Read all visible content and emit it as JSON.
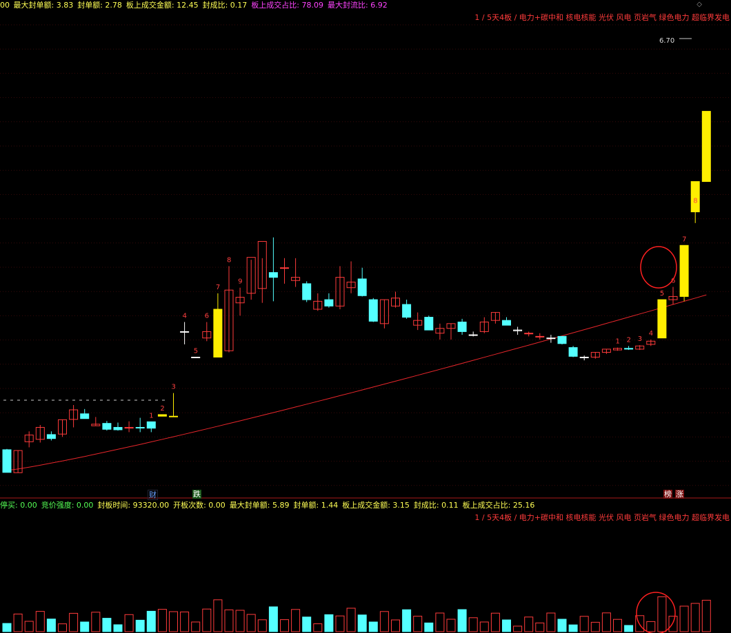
{
  "top_stats": [
    {
      "label": "最大封单额: ",
      "value": "3.83",
      "color": "#ffff55"
    },
    {
      "label": "封单额: ",
      "value": "2.78",
      "color": "#ffff55"
    },
    {
      "label": "板上成交金额: ",
      "value": "12.45",
      "color": "#ffff55"
    },
    {
      "label": "封成比: ",
      "value": "0.17",
      "color": "#ffff55"
    },
    {
      "label": "板上成交占比: ",
      "value": "78.09",
      "color": "#ff44ff"
    },
    {
      "label": "最大封流比: ",
      "value": "6.92",
      "color": "#ff44ff"
    }
  ],
  "top_prefix": "00",
  "concepts": "1 / 5天4板 / 电力+碳中和 核电核能 光伏 风电 页岩气 绿色电力 超临界发电",
  "price_label": "6.70",
  "ma_color": "#e8262b",
  "flags": {
    "cai": "财",
    "die": "跌",
    "bang": "榜",
    "zhang": "涨"
  },
  "bottom_stats": [
    {
      "label": "停买: ",
      "value": "0.00",
      "color": "#55ff55"
    },
    {
      "label": "竞价强度: ",
      "value": "0.00",
      "color": "#55ff55"
    },
    {
      "label": "封板时间: ",
      "value": "93320.00",
      "color": "#ffff55"
    },
    {
      "label": "开板次数: ",
      "value": "0.00",
      "color": "#ffff55"
    },
    {
      "label": "最大封单额: ",
      "value": "5.89",
      "color": "#ffff55"
    },
    {
      "label": "封单额: ",
      "value": "1.44",
      "color": "#ffff55"
    },
    {
      "label": "板上成交金额: ",
      "value": "3.15",
      "color": "#ffff55"
    },
    {
      "label": "封成比: ",
      "value": "0.11",
      "color": "#ffff55"
    },
    {
      "label": "板上成交占比: ",
      "value": "25.16",
      "color": "#ffff55"
    }
  ],
  "chart_data": {
    "type": "candlestick",
    "candles": [
      {
        "o": 6.8,
        "h": 6.85,
        "l": 5.38,
        "c": 5.38,
        "dir": "down"
      },
      {
        "o": 5.36,
        "h": 6.75,
        "l": 5.36,
        "c": 6.75,
        "dir": "up"
      },
      {
        "o": 7.3,
        "h": 7.95,
        "l": 6.95,
        "c": 7.72,
        "dir": "up"
      },
      {
        "o": 7.45,
        "h": 8.35,
        "l": 7.25,
        "c": 8.2,
        "dir": "up"
      },
      {
        "o": 7.75,
        "h": 7.95,
        "l": 7.38,
        "c": 7.5,
        "dir": "down"
      },
      {
        "o": 7.78,
        "h": 8.68,
        "l": 7.6,
        "c": 8.68,
        "dir": "up"
      },
      {
        "o": 8.7,
        "h": 9.6,
        "l": 8.2,
        "c": 9.3,
        "dir": "up"
      },
      {
        "o": 9.05,
        "h": 9.35,
        "l": 8.85,
        "c": 8.75,
        "dir": "down"
      },
      {
        "o": 8.4,
        "h": 8.85,
        "l": 8.3,
        "c": 8.3,
        "dir": "up"
      },
      {
        "o": 8.45,
        "h": 8.6,
        "l": 8.0,
        "c": 8.08,
        "dir": "down"
      },
      {
        "o": 8.2,
        "h": 8.5,
        "l": 8.0,
        "c": 8.05,
        "dir": "down"
      },
      {
        "o": 8.2,
        "h": 8.58,
        "l": 7.9,
        "c": 8.15,
        "dir": "up"
      },
      {
        "o": 8.2,
        "h": 8.8,
        "l": 7.9,
        "c": 8.2,
        "dir": "down"
      },
      {
        "o": 8.15,
        "h": 8.55,
        "l": 7.9,
        "c": 8.55,
        "dir": "down"
      },
      {
        "o": 8.9,
        "h": 9.0,
        "l": 8.9,
        "c": 9.0,
        "dir": "limit"
      },
      {
        "o": 8.9,
        "h": 10.35,
        "l": 8.85,
        "c": 8.9,
        "dir": "limit"
      },
      {
        "o": 14.2,
        "h": 14.8,
        "l": 13.4,
        "c": 14.2,
        "dir": "flat"
      },
      {
        "o": 12.6,
        "h": 12.6,
        "l": 12.6,
        "c": 12.6,
        "dir": "flat"
      },
      {
        "o": 13.8,
        "h": 14.8,
        "l": 13.6,
        "c": 14.2,
        "dir": "up"
      },
      {
        "o": 15.6,
        "h": 16.6,
        "l": 13.3,
        "c": 12.6,
        "dir": "limit"
      },
      {
        "o": 13.0,
        "h": 18.3,
        "l": 12.9,
        "c": 16.8,
        "dir": "up"
      },
      {
        "o": 16.0,
        "h": 16.95,
        "l": 15.2,
        "c": 16.35,
        "dir": "up"
      },
      {
        "o": 16.6,
        "h": 18.7,
        "l": 16.2,
        "c": 18.85,
        "dir": "up"
      },
      {
        "o": 16.9,
        "h": 18.8,
        "l": 16.0,
        "c": 19.85,
        "dir": "up"
      },
      {
        "o": 17.9,
        "h": 20.1,
        "l": 16.1,
        "c": 17.6,
        "dir": "down"
      },
      {
        "o": 18.2,
        "h": 18.8,
        "l": 17.2,
        "c": 18.2,
        "dir": "up"
      },
      {
        "o": 17.6,
        "h": 18.8,
        "l": 17.0,
        "c": 17.4,
        "dir": "up"
      },
      {
        "o": 17.2,
        "h": 17.35,
        "l": 16.05,
        "c": 16.2,
        "dir": "down"
      },
      {
        "o": 15.6,
        "h": 16.6,
        "l": 15.5,
        "c": 16.1,
        "dir": "up"
      },
      {
        "o": 16.2,
        "h": 16.6,
        "l": 15.7,
        "c": 15.8,
        "dir": "down"
      },
      {
        "o": 15.8,
        "h": 18.3,
        "l": 15.6,
        "c": 17.6,
        "dir": "up"
      },
      {
        "o": 17.3,
        "h": 18.6,
        "l": 16.6,
        "c": 16.95,
        "dir": "up"
      },
      {
        "o": 17.5,
        "h": 18.2,
        "l": 16.4,
        "c": 16.45,
        "dir": "down"
      },
      {
        "o": 16.2,
        "h": 16.3,
        "l": 14.8,
        "c": 14.85,
        "dir": "down"
      },
      {
        "o": 14.7,
        "h": 16.2,
        "l": 14.4,
        "c": 16.2,
        "dir": "up"
      },
      {
        "o": 16.3,
        "h": 16.7,
        "l": 15.7,
        "c": 15.8,
        "dir": "up"
      },
      {
        "o": 15.9,
        "h": 16.2,
        "l": 15.0,
        "c": 15.1,
        "dir": "down"
      },
      {
        "o": 14.9,
        "h": 15.4,
        "l": 14.3,
        "c": 14.6,
        "dir": "up"
      },
      {
        "o": 15.1,
        "h": 15.2,
        "l": 14.3,
        "c": 14.3,
        "dir": "down"
      },
      {
        "o": 14.4,
        "h": 14.7,
        "l": 13.7,
        "c": 14.1,
        "dir": "up"
      },
      {
        "o": 14.4,
        "h": 14.7,
        "l": 13.7,
        "c": 14.7,
        "dir": "up"
      },
      {
        "o": 14.8,
        "h": 15.0,
        "l": 14.0,
        "c": 14.2,
        "dir": "down"
      },
      {
        "o": 14.0,
        "h": 14.2,
        "l": 13.9,
        "c": 14.0,
        "dir": "flat"
      },
      {
        "o": 14.2,
        "h": 15.1,
        "l": 14.1,
        "c": 14.8,
        "dir": "up"
      },
      {
        "o": 14.9,
        "h": 15.4,
        "l": 14.7,
        "c": 15.4,
        "dir": "up"
      },
      {
        "o": 14.9,
        "h": 15.1,
        "l": 14.6,
        "c": 14.6,
        "dir": "down"
      },
      {
        "o": 14.3,
        "h": 14.5,
        "l": 14.0,
        "c": 14.25,
        "dir": "flat"
      },
      {
        "o": 14.1,
        "h": 14.2,
        "l": 13.9,
        "c": 14.1,
        "dir": "up"
      },
      {
        "o": 13.9,
        "h": 14.1,
        "l": 13.7,
        "c": 13.9,
        "dir": "up"
      },
      {
        "o": 13.8,
        "h": 14.0,
        "l": 13.5,
        "c": 13.8,
        "dir": "flat"
      },
      {
        "o": 13.9,
        "h": 13.9,
        "l": 13.4,
        "c": 13.45,
        "dir": "down"
      },
      {
        "o": 13.2,
        "h": 13.3,
        "l": 12.6,
        "c": 12.65,
        "dir": "down"
      },
      {
        "o": 12.6,
        "h": 12.7,
        "l": 12.4,
        "c": 12.6,
        "dir": "flat"
      },
      {
        "o": 12.6,
        "h": 12.9,
        "l": 12.5,
        "c": 12.9,
        "dir": "up"
      },
      {
        "o": 12.9,
        "h": 13.1,
        "l": 12.8,
        "c": 13.1,
        "dir": "up"
      },
      {
        "o": 13.05,
        "h": 13.2,
        "l": 13.0,
        "c": 13.15,
        "dir": "up"
      },
      {
        "o": 13.15,
        "h": 13.3,
        "l": 13.05,
        "c": 13.1,
        "dir": "down"
      },
      {
        "o": 13.1,
        "h": 13.35,
        "l": 13.05,
        "c": 13.3,
        "dir": "up"
      },
      {
        "o": 13.4,
        "h": 13.7,
        "l": 13.3,
        "c": 13.6,
        "dir": "up"
      },
      {
        "o": 13.8,
        "h": 16.2,
        "l": 13.8,
        "c": 16.2,
        "dir": "limit"
      },
      {
        "o": 16.2,
        "h": 17.0,
        "l": 15.9,
        "c": 16.4,
        "dir": "up"
      },
      {
        "o": 16.4,
        "h": 19.6,
        "l": 16.1,
        "c": 19.6,
        "dir": "limit"
      },
      {
        "o": 21.7,
        "h": 22.0,
        "l": 21.0,
        "c": 23.6,
        "dir": "limit"
      },
      {
        "o": 23.6,
        "h": 28.0,
        "l": 23.6,
        "c": 28.0,
        "dir": "limit"
      }
    ]
  }
}
